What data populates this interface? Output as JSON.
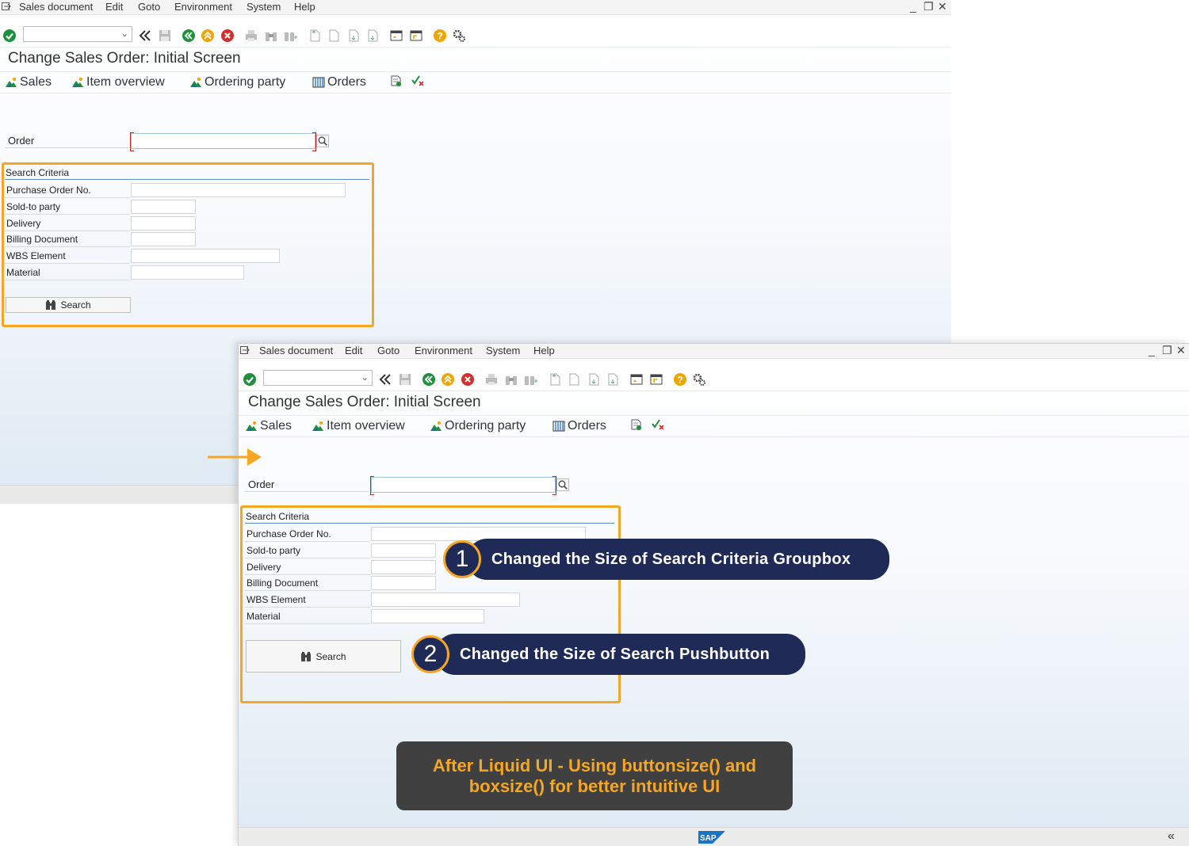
{
  "menu": {
    "items": [
      "Sales document",
      "Edit",
      "Goto",
      "Environment",
      "System",
      "Help"
    ],
    "window_controls": [
      "_",
      "❐",
      "✕"
    ]
  },
  "toolbar": {
    "command_field_value": "",
    "icons": [
      "enter-icon",
      "back-double-icon",
      "save-icon",
      "back-icon",
      "exit-icon",
      "cancel-icon",
      "print-icon",
      "find-icon",
      "find-next-icon",
      "first-page-icon",
      "prev-page-icon",
      "next-page-icon",
      "last-page-icon",
      "new-session-icon",
      "shortcut-icon",
      "help-icon",
      "settings-icon"
    ]
  },
  "screen": {
    "title": "Change Sales Order: Initial Screen",
    "app_toolbar": {
      "sales": "Sales",
      "item_overview": "Item overview",
      "ordering_party": "Ordering party",
      "orders": "Orders"
    },
    "order_label": "Order",
    "order_value": ""
  },
  "search_criteria": {
    "title": "Search Criteria",
    "fields": [
      {
        "label": "Purchase Order No.",
        "value": ""
      },
      {
        "label": "Sold-to party",
        "value": ""
      },
      {
        "label": "Delivery",
        "value": ""
      },
      {
        "label": "Billing Document",
        "value": ""
      },
      {
        "label": "WBS Element",
        "value": ""
      },
      {
        "label": "Material",
        "value": ""
      }
    ],
    "search_button": "Search"
  },
  "callouts": {
    "one_number": "1",
    "one_text": "Changed the Size of Search Criteria Groupbox",
    "two_number": "2",
    "two_text": "Changed the Size of Search Pushbutton",
    "banner_line1": "After Liquid UI - Using buttonsize() and",
    "banner_line2": "boxsize() for better intuitive UI"
  },
  "status": {
    "logo": "SAP",
    "collapse": "«"
  },
  "colors": {
    "accent_orange": "#f5a623",
    "callout_navy": "#1f2a57",
    "banner_gray": "#404040"
  }
}
